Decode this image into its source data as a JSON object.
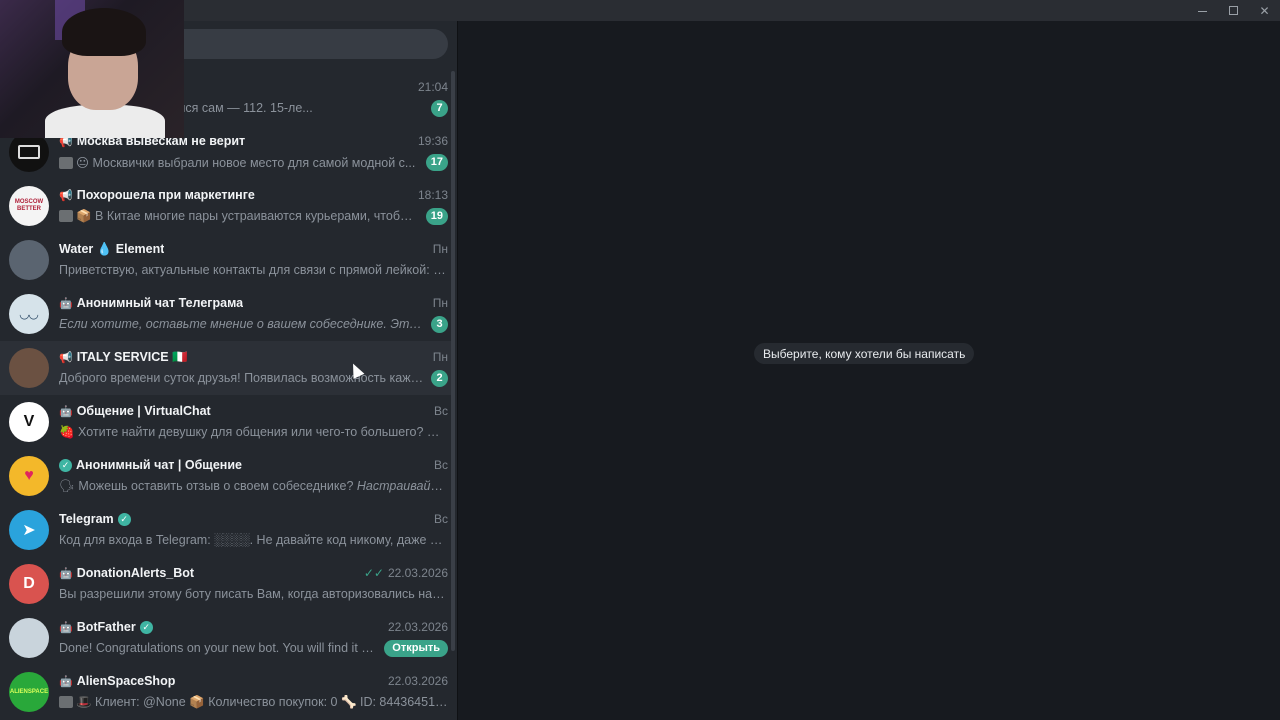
{
  "empty_hint": "Выберите, кому хотели бы написать",
  "colors": {
    "accent": "#3aa389",
    "verified": "#3fb5a3",
    "sidebar_bg": "#24282e",
    "main_bg": "#171a1f"
  },
  "chats": [
    {
      "name": "",
      "type": "",
      "time": "21:04",
      "preview": "ёк заправку и загорелся сам — 112. 15-ле...",
      "badge": "7",
      "avatar_color": "#3b3f45",
      "avatar_icon": ""
    },
    {
      "name": "Москва вывескам не верит",
      "type": "channel",
      "time": "19:36",
      "preview": "😐 Москвички выбрали новое место для самой модной с...",
      "badge": "17",
      "avatar_color": "#111111",
      "avatar_icon": "signboard-icon"
    },
    {
      "name": "Похорошела при маркетинге",
      "type": "channel",
      "time": "18:13",
      "preview": "📦 В Китае многие пары устраиваются курьерами, чтобы бо...",
      "badge": "19",
      "avatar_color": "#f4f4f4",
      "avatar_icon": "moscow-better-logo",
      "avatar_text": "MOSCOW BETTER"
    },
    {
      "name": "Water 💧 Element",
      "type": "",
      "time": "Пн",
      "preview": "Приветствую, актуальные контакты для связи с прямой лейкой: @Ва...",
      "badge": "",
      "avatar_color": "#5a6470",
      "avatar_icon": "landscape-photo"
    },
    {
      "name": "Анонимный чат Телеграма",
      "type": "bot",
      "time": "Пн",
      "preview": "Если хотите, оставьте мнение о вашем собеседнике. Это помож...",
      "preview_italic": true,
      "badge": "3",
      "avatar_color": "#d6e3ea",
      "avatar_icon": "mask-icon"
    },
    {
      "name": "ITALY SERVICE 🇮🇹",
      "type": "channel",
      "time": "Пн",
      "preview": "Доброго времени суток друзья! Появилась возможность каждом...",
      "badge": "2",
      "avatar_color": "#6b5142",
      "avatar_icon": "group-photo",
      "hover": true
    },
    {
      "name": "Общение | VirtualChat",
      "type": "bot",
      "time": "Вс",
      "preview": "🍓 Хотите найти девушку для общения или чего-то большего? Посм...",
      "badge": "",
      "avatar_color": "#ffffff",
      "avatar_icon": "v-logo"
    },
    {
      "name": "Анонимный чат | Общение",
      "type": "verified-bot",
      "time": "Вс",
      "preview": "🗣 Можешь оставить отзыв о своем собеседнике? ",
      "preview_extra": "Настраивайте и...",
      "badge": "",
      "avatar_color": "#f3b82a",
      "avatar_icon": "heart-icon"
    },
    {
      "name": "Telegram",
      "type": "",
      "verified": true,
      "time": "Вс",
      "preview": "Код для входа в Telegram: ░░░░. Не давайте код никому, даже если ...",
      "badge": "",
      "avatar_color": "#2aa3dc",
      "avatar_icon": "paper-plane-icon"
    },
    {
      "name": "DonationAlerts_Bot",
      "type": "bot",
      "time": "22.03.2026",
      "read_check": true,
      "preview": "Вы разрешили этому боту писать Вам, когда авторизовались на www...",
      "badge": "",
      "avatar_color": "#d9534f",
      "avatar_letter": "D",
      "avatar_icon": "letter-avatar"
    },
    {
      "name": "BotFather",
      "type": "bot",
      "verified": true,
      "time": "22.03.2026",
      "preview": "Done! Congratulations on your new bot. You will find it at t.m...",
      "badge": "",
      "button": "Открыть",
      "avatar_color": "#c9d4dc",
      "avatar_icon": "botfather-photo"
    },
    {
      "name": "AlienSpaceShop",
      "type": "bot",
      "time": "22.03.2026",
      "preview": "🎩 Клиент: @None 📦 Количество покупок: 0 🦴 ID: 8443645137 💰 Б...",
      "badge": "",
      "avatar_color": "#29a83a",
      "avatar_icon": "alien-icon",
      "avatar_text": "ALIENSPACE"
    }
  ]
}
